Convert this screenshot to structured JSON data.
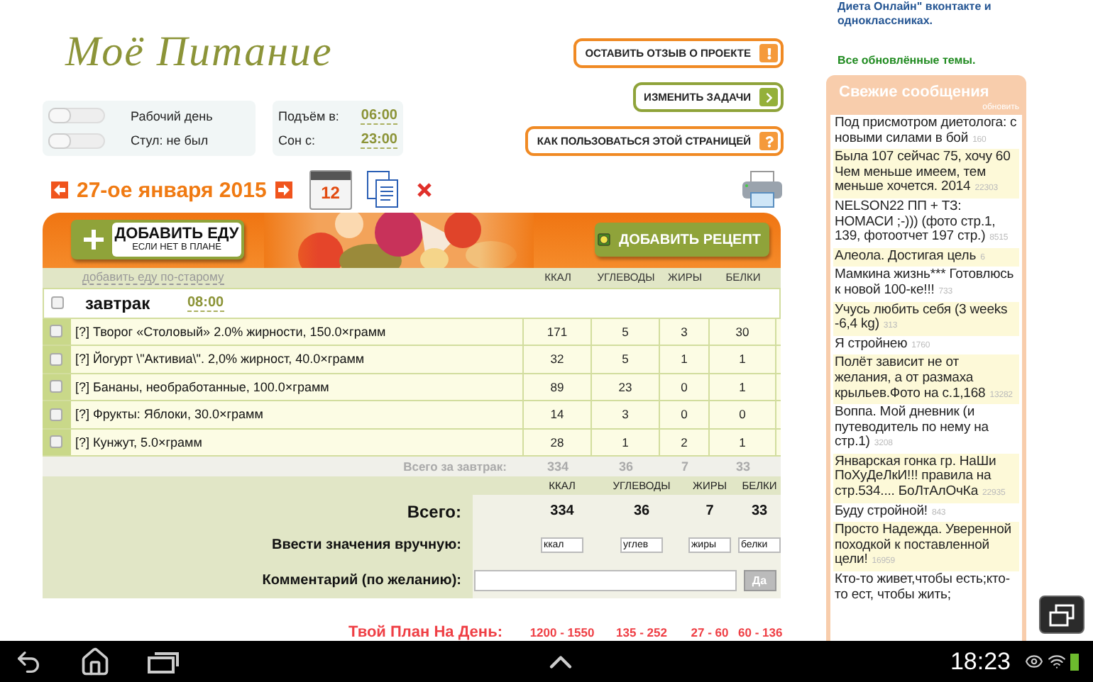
{
  "logo": "Моё Питание",
  "toggles": [
    {
      "label": "Рабочий день",
      "on": false
    },
    {
      "label": "Стул: не был",
      "on": false
    }
  ],
  "times": [
    {
      "label": "Подъём в:",
      "value": "06:00"
    },
    {
      "label": "Сон с:",
      "value": "23:00"
    }
  ],
  "action_buttons": [
    {
      "label": "ОСТАВИТЬ ОТЗЫВ О ПРОЕКТЕ",
      "kind": "warning"
    },
    {
      "label": "ИЗМЕНИТЬ ЗАДАЧИ",
      "kind": "arrow"
    },
    {
      "label": "КАК ПОЛЬЗОВАТЬСЯ ЭТОЙ СТРАНИЦЕЙ",
      "kind": "help"
    }
  ],
  "date": "27-ое января 2015",
  "calendar_day": "12",
  "add_food": {
    "title": "ДОБАВИТЬ ЕДУ",
    "subtitle": "ЕСЛИ НЕТ В ПЛАНЕ"
  },
  "add_recipe": "ДОБАВИТЬ РЕЦЕПТ",
  "old_way_link": "добавить еду по-старому",
  "columns": [
    "ККАЛ",
    "УГЛЕВОДЫ",
    "ЖИРЫ",
    "БЕЛКИ"
  ],
  "meal": {
    "name": "завтрак",
    "time": "08:00",
    "checked": false,
    "items": [
      {
        "name": "[?] Творог «Столовый» 2.0% жирности, 150.0×грамм",
        "values": [
          "171",
          "5",
          "3",
          "30"
        ],
        "checked": false
      },
      {
        "name": "[?] Йогурт \\\"Активиа\\\". 2,0% жирност, 40.0×грамм",
        "values": [
          "32",
          "5",
          "1",
          "1"
        ],
        "checked": false
      },
      {
        "name": "[?] Бананы, необработанные, 100.0×грамм",
        "values": [
          "89",
          "23",
          "0",
          "1"
        ],
        "checked": false
      },
      {
        "name": "[?] Фрукты: Яблоки, 30.0×грамм",
        "values": [
          "14",
          "3",
          "0",
          "0"
        ],
        "checked": false
      },
      {
        "name": "[?] Кунжут, 5.0×грамм",
        "values": [
          "28",
          "1",
          "2",
          "1"
        ],
        "checked": false
      }
    ],
    "total_label": "Всего за завтрак:",
    "totals": [
      "334",
      "36",
      "7",
      "33"
    ]
  },
  "summary": {
    "columns": [
      "ККАЛ",
      "УГЛЕВОДЫ",
      "ЖИРЫ",
      "БЕЛКИ"
    ],
    "total_label": "Всего:",
    "totals": [
      "334",
      "36",
      "7",
      "33"
    ],
    "manual_label": "Ввести значения вручную:",
    "manual_values": [
      "ккал",
      "углев",
      "жиры",
      "белки"
    ],
    "comment_label": "Комментарий (по желанию):",
    "submit": "Да"
  },
  "plan": {
    "label": "Твой План На День:",
    "values": [
      "1200 - 1550",
      "135 - 252",
      "27 - 60",
      "60 - 136"
    ]
  },
  "sidebar": {
    "cut_text": "Диета Онлайн\" вконтакте и одноклассниках.",
    "updated_link": "Все обновлённые темы.",
    "title": "Свежие сообщения",
    "refresh": "обновить",
    "messages": [
      {
        "text": "Под присмотром диетолога: с новыми силами в бой",
        "count": "160",
        "highlighted": false
      },
      {
        "text": "Была 107 сейчас 75, хочу 60 Чем меньше имеем, тем меньше хочется. 2014",
        "count": "22303",
        "highlighted": true
      },
      {
        "text": "NELSON22 ПП + ТЗ: НОМАСИ ;-))) (фото стр.1, 139, фотоотчет 197 стр.)",
        "count": "8515",
        "highlighted": false
      },
      {
        "text": "Алеола. Достигая цель",
        "count": "6",
        "highlighted": true
      },
      {
        "text": "Мамкина жизнь*** Готовлюсь к новой 100-ке!!!",
        "count": "733",
        "highlighted": false
      },
      {
        "text": "Учусь любить себя (3 weeks -6,4 kg)",
        "count": "313",
        "highlighted": true
      },
      {
        "text": "Я стройнею",
        "count": "1760",
        "highlighted": false
      },
      {
        "text": "Полёт зависит не от желания, а от размаха крыльев.Фото на с.1,168",
        "count": "13282",
        "highlighted": true
      },
      {
        "text": "Воппа. Мой дневник (и путеводитель по нему на стр.1)",
        "count": "3208",
        "highlighted": false
      },
      {
        "text": "Январская гонка гр. НаШи ПоХуДеЛкИ!!! правила на стр.534.... БоЛтАлОчКа",
        "count": "22935",
        "highlighted": true
      },
      {
        "text": "Буду стройной!",
        "count": "843",
        "highlighted": false
      },
      {
        "text": "Просто Надежда. Уверенной походкой к поставленной цели!",
        "count": "16959",
        "highlighted": true
      },
      {
        "text": "Кто-то живет,чтобы есть;кто-то ест, чтобы жить;",
        "highlighted": false
      }
    ]
  },
  "status_bar": {
    "time": "18:23"
  }
}
